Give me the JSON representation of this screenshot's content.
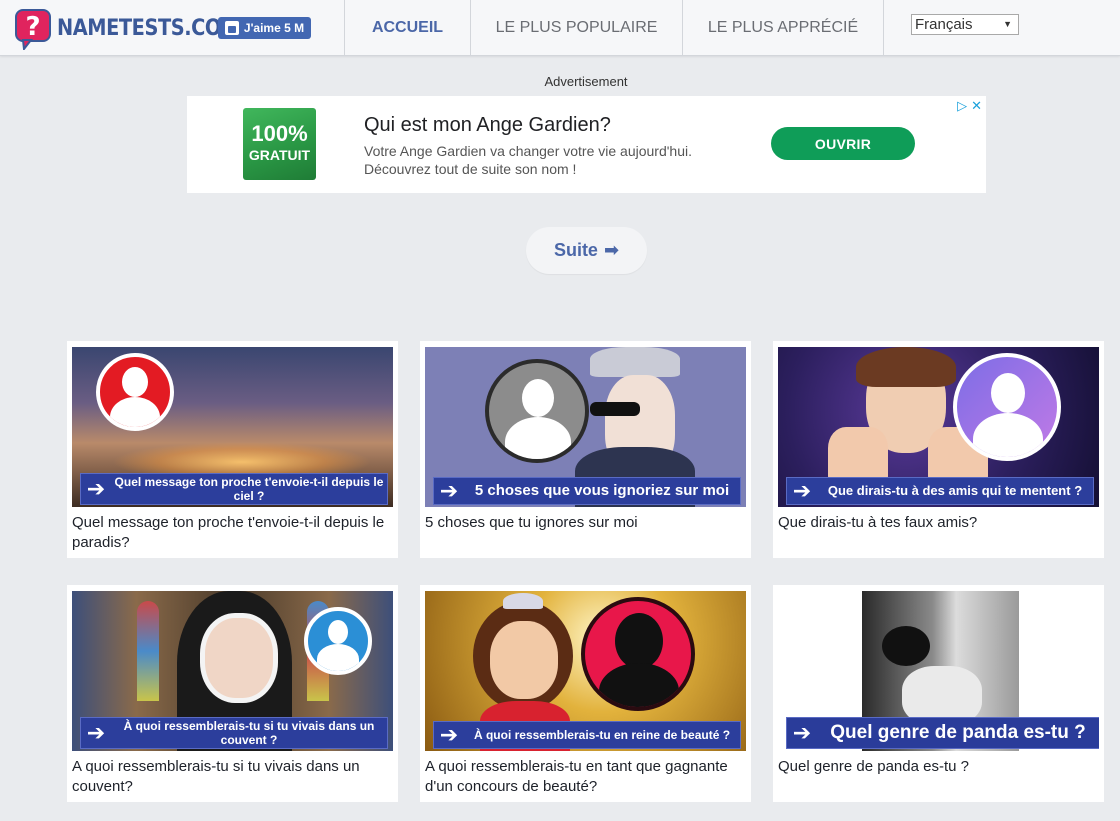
{
  "header": {
    "logo_text": "NAMETESTS.COM",
    "fb_like_label": "J'aime 5 M",
    "nav": [
      {
        "label": "ACCUEIL",
        "active": true
      },
      {
        "label": "LE PLUS POPULAIRE",
        "active": false
      },
      {
        "label": "LE PLUS APPRÉCIÉ",
        "active": false
      }
    ],
    "language": "Français"
  },
  "ad": {
    "label": "Advertisement",
    "badge_line1": "100%",
    "badge_line2": "GRATUIT",
    "title": "Qui est mon Ange Gardien?",
    "description": "Votre Ange Gardien va changer votre vie aujourd'hui. Découvrez tout de suite son nom !",
    "cta": "OUVRIR"
  },
  "suite_label": "Suite",
  "cards": [
    {
      "banner": "Quel message ton proche t'envoie-t-il depuis le ciel ?",
      "title": "Quel message ton proche t'envoie-t-il depuis le paradis?"
    },
    {
      "banner": "5 choses que vous ignoriez sur moi",
      "title": "5 choses que tu ignores sur moi"
    },
    {
      "banner": "Que dirais-tu à des amis qui te mentent ?",
      "title": "Que dirais-tu à tes faux amis?"
    },
    {
      "banner": "À quoi ressemblerais-tu si tu vivais dans un couvent ?",
      "title": "A quoi ressemblerais-tu si tu vivais dans un couvent?"
    },
    {
      "banner": "À quoi ressemblerais-tu en reine de beauté ?",
      "title": "A quoi ressemblerais-tu en tant que gagnante d'un concours de beauté?"
    },
    {
      "banner": "Quel genre de panda es-tu ?",
      "title": "Quel genre de panda es-tu ?"
    }
  ],
  "colors": {
    "brand": "#4b67a8",
    "banner": "#2c3e9c",
    "ad_cta": "#0f9d58",
    "logo_badge": "#e0245e"
  }
}
